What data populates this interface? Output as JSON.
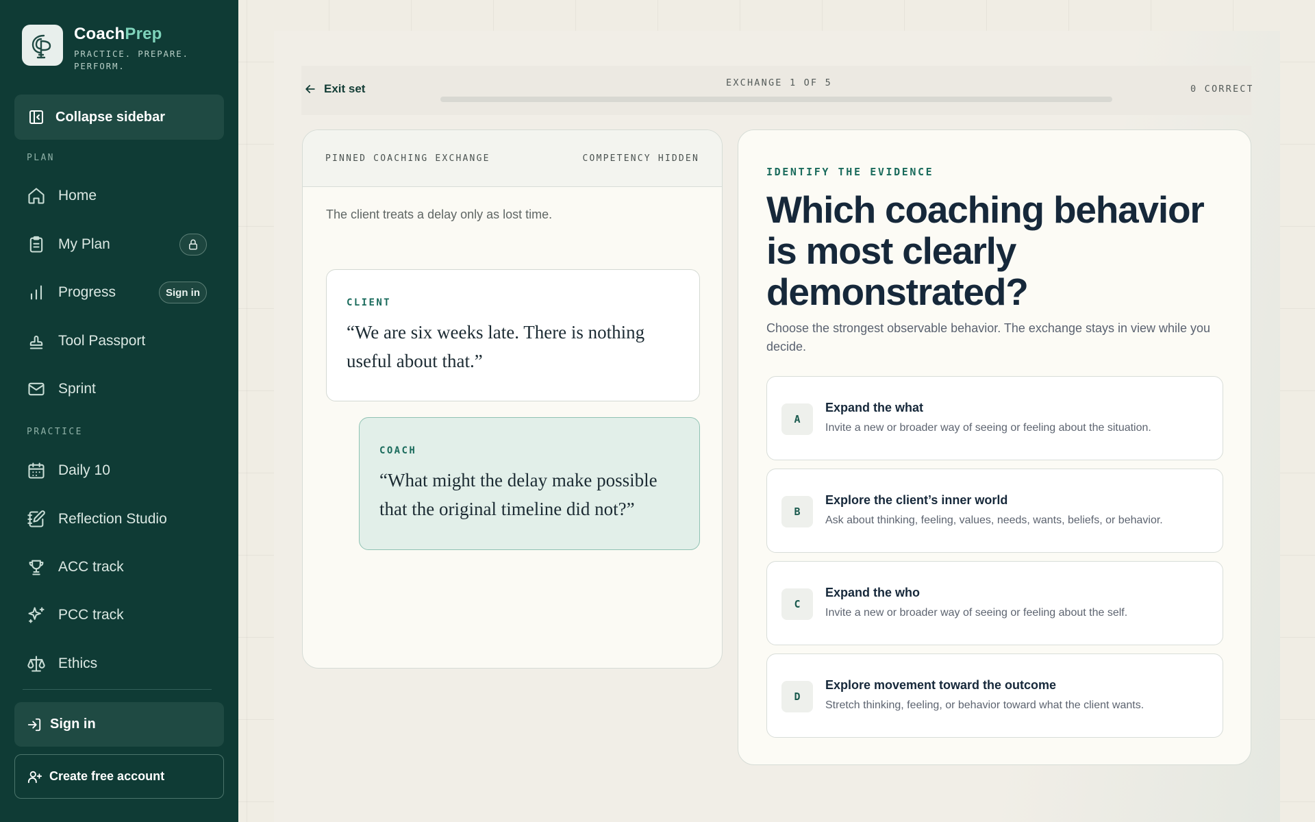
{
  "brand": {
    "name_part1": "Coach",
    "name_part2": "Prep",
    "tagline": "PRACTICE. PREPARE. PERFORM.",
    "accent_color": "#7fd4bb"
  },
  "sidebar": {
    "collapse_label": "Collapse sidebar",
    "plan_section": "PLAN",
    "practice_section": "PRACTICE",
    "items": [
      {
        "label": "Home",
        "icon": "home-icon"
      },
      {
        "label": "My Plan",
        "icon": "clipboard-icon",
        "badge": "lock-icon"
      },
      {
        "label": "Progress",
        "icon": "bar-chart-icon",
        "badge_text": "Sign in"
      },
      {
        "label": "Tool Passport",
        "icon": "stamp-icon"
      },
      {
        "label": "Sprint",
        "icon": "mail-icon"
      },
      {
        "label": "Daily 10",
        "icon": "calendar-icon"
      },
      {
        "label": "Reflection Studio",
        "icon": "notebook-pen-icon"
      },
      {
        "label": "ACC track",
        "icon": "trophy-icon"
      },
      {
        "label": "PCC track",
        "icon": "sparkles-icon"
      },
      {
        "label": "Ethics",
        "icon": "scale-icon"
      }
    ],
    "sign_in": "Sign in",
    "create_account": "Create free account",
    "bg_color": "#0f3b35"
  },
  "topbar": {
    "exit_label": "Exit set",
    "exchange_label": "EXCHANGE 1 OF 5",
    "progress": 0.0,
    "correct_label": "0 CORRECT"
  },
  "exchange": {
    "header_left": "PINNED COACHING EXCHANGE",
    "header_right": "COMPETENCY HIDDEN",
    "context": "The client treats a delay only as lost time.",
    "client_label": "CLIENT",
    "client_quote": "“We are six weeks late. There is nothing useful about that.”",
    "coach_label": "COACH",
    "coach_quote": "“What might the delay make possible that the original timeline did not?”"
  },
  "question": {
    "eyebrow": "IDENTIFY THE EVIDENCE",
    "title": "Which coaching behavior is most clearly demonstrated?",
    "subtitle": "Choose the strongest observable behavior. The exchange stays in view while you decide.",
    "options": [
      {
        "letter": "A",
        "title": "Expand the what",
        "desc": "Invite a new or broader way of seeing or feeling about the situation."
      },
      {
        "letter": "B",
        "title": "Explore the client’s inner world",
        "desc": "Ask about thinking, feeling, values, needs, wants, beliefs, or behavior."
      },
      {
        "letter": "C",
        "title": "Expand the who",
        "desc": "Invite a new or broader way of seeing or feeling about the self."
      },
      {
        "letter": "D",
        "title": "Explore movement toward the outcome",
        "desc": "Stretch thinking, feeling, or behavior toward what the client wants."
      }
    ]
  }
}
